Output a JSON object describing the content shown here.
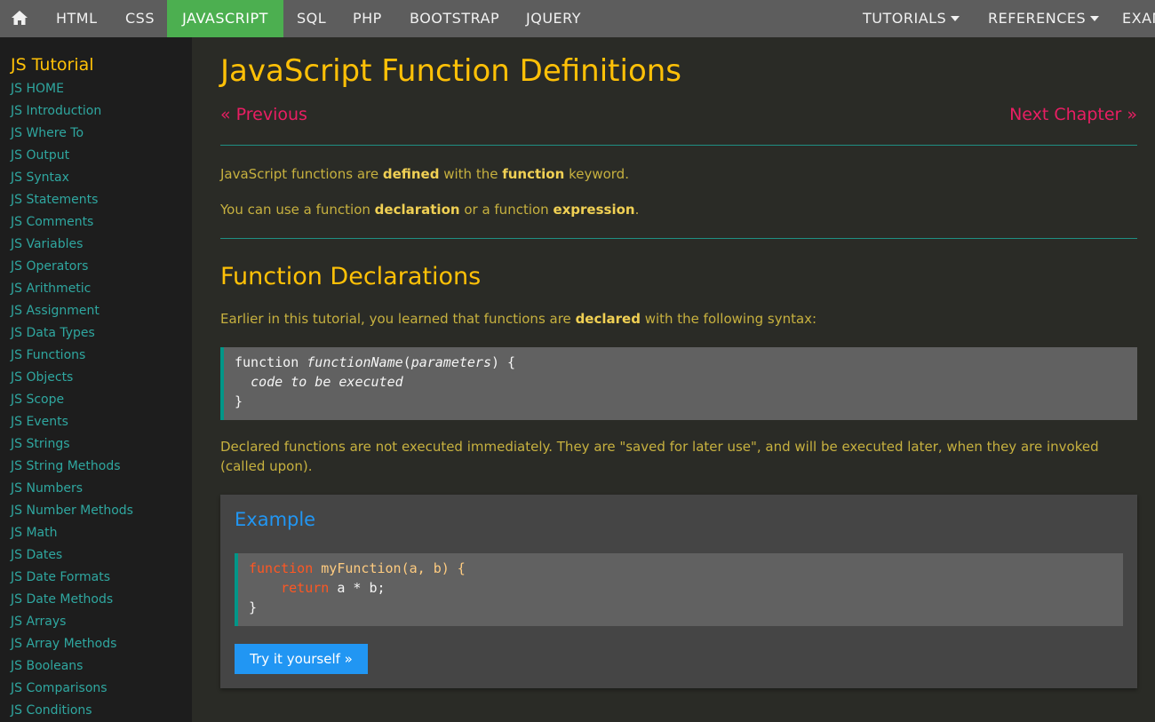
{
  "nav": {
    "items": [
      "HTML",
      "CSS",
      "JAVASCRIPT",
      "SQL",
      "PHP",
      "BOOTSTRAP",
      "JQUERY"
    ],
    "right_items": [
      "TUTORIALS",
      "REFERENCES",
      "EXAM"
    ],
    "active": "JAVASCRIPT",
    "active_color": "#4caf50"
  },
  "sidebar": {
    "title": "JS Tutorial",
    "items": [
      "JS HOME",
      "JS Introduction",
      "JS Where To",
      "JS Output",
      "JS Syntax",
      "JS Statements",
      "JS Comments",
      "JS Variables",
      "JS Operators",
      "JS Arithmetic",
      "JS Assignment",
      "JS Data Types",
      "JS Functions",
      "JS Objects",
      "JS Scope",
      "JS Events",
      "JS Strings",
      "JS String Methods",
      "JS Numbers",
      "JS Number Methods",
      "JS Math",
      "JS Dates",
      "JS Date Formats",
      "JS Date Methods",
      "JS Arrays",
      "JS Array Methods",
      "JS Booleans",
      "JS Comparisons",
      "JS Conditions"
    ]
  },
  "main": {
    "title": "JavaScript Function Definitions",
    "prev": "« Previous",
    "next": "Next Chapter »",
    "intro": {
      "p1_a": "JavaScript functions are ",
      "p1_b": "defined",
      "p1_c": " with the ",
      "p1_d": "function",
      "p1_e": " keyword.",
      "p2_a": "You can use a function ",
      "p2_b": "declaration",
      "p2_c": " or a function ",
      "p2_d": "expression",
      "p2_e": "."
    },
    "section_title": "Function Declarations",
    "decl_para": {
      "a": "Earlier in this tutorial, you learned that functions are ",
      "b": "declared",
      "c": " with the following syntax:"
    },
    "syntax": {
      "l1_a": "function ",
      "l1_b": "functionName",
      "l1_c": "(",
      "l1_d": "parameters",
      "l1_e": ") {",
      "l2": "code to be executed",
      "l3": "}"
    },
    "note": "Declared functions are not executed immediately. They are \"saved for later use\", and will be executed later, when they are invoked (called upon).",
    "example": {
      "title": "Example",
      "code": {
        "l1_kw": "function",
        "l1_rest": " myFunction(a, b) {",
        "l2_kw": "return",
        "l2_rest": " a * b;",
        "l3": "}"
      },
      "button": "Try it yourself »"
    }
  },
  "colors": {
    "accent_yellow": "#ffc107",
    "link_pink": "#e91e63",
    "sidebar_link": "#2fa7a0",
    "example_blue": "#2196f3"
  }
}
